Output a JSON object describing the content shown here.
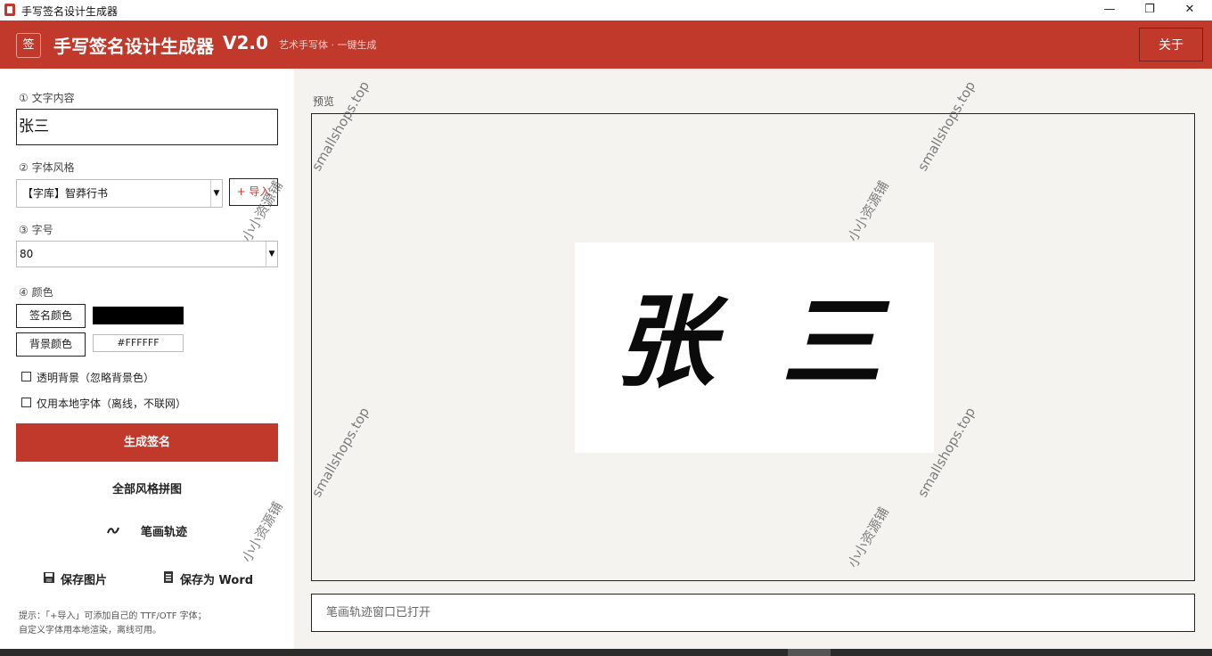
{
  "window": {
    "title": "手写签名设计生成器",
    "minimize": "—",
    "maximize": "❐",
    "close": "✕"
  },
  "header": {
    "logo_glyph": "签",
    "title": "手写签名设计生成器",
    "version": "V2.0",
    "subtitle": "艺术手写体 · 一键生成",
    "about_label": "关于",
    "accent_color": "#c0392b"
  },
  "form": {
    "text_label": "① 文字内容",
    "text_value": "张三",
    "style_label": "② 字体风格",
    "style_value": "【字库】智莽行书",
    "import_label": "+ 导入",
    "size_label": "③ 字号",
    "size_value": "80",
    "color_label": "④ 颜色",
    "sign_color_label": "签名颜色",
    "sign_color_value": "#000000",
    "bg_color_label": "背景颜色",
    "bg_color_value": "#FFFFFF",
    "transparent_label": "透明背景（忽略背景色）",
    "transparent_checked": false,
    "local_font_label": "仅用本地字体（离线，不联网）",
    "local_font_checked": false
  },
  "actions": {
    "generate": "生成签名",
    "all_styles": "全部风格拼图",
    "stroke_trace": "笔画轨迹",
    "save_image": "保存图片",
    "save_word": "保存为 Word"
  },
  "hint": {
    "line1": "提示：「+导入」可添加自己的 TTF/OTF 字体；",
    "line2": "自定义字体用本地渲染，离线可用。"
  },
  "preview": {
    "label": "预览",
    "signature_text": "张 三",
    "status": "笔画轨迹窗口已打开"
  },
  "watermarks": {
    "site": "smallshops.top",
    "shop": "小小资源铺"
  }
}
